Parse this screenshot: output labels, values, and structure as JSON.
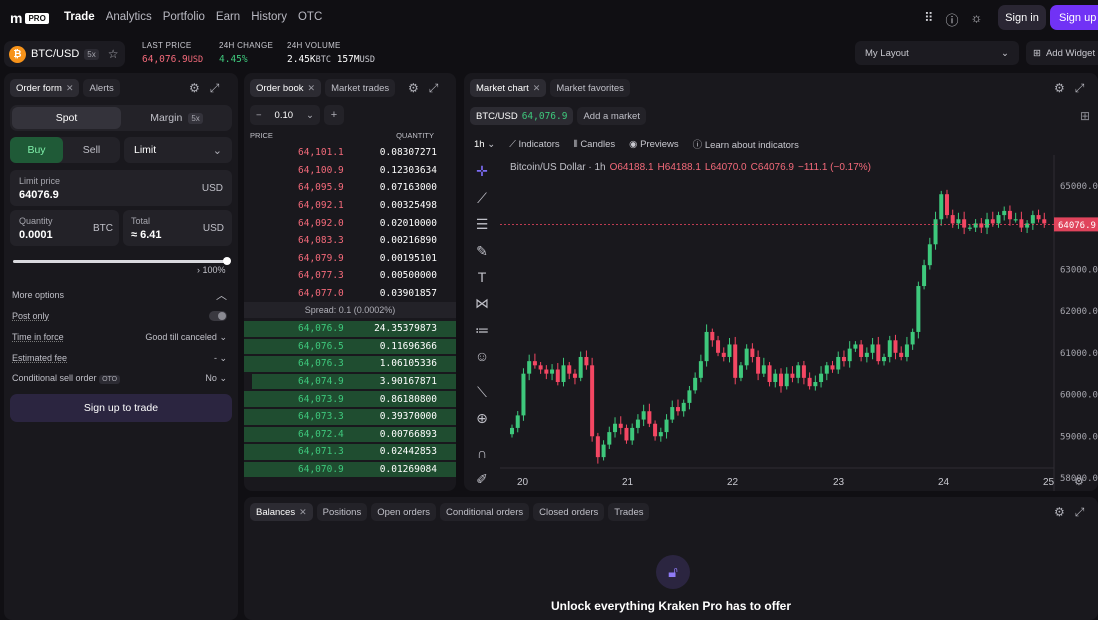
{
  "brand": {
    "logo": "m",
    "badge": "PRO"
  },
  "nav": [
    "Trade",
    "Analytics",
    "Portfolio",
    "Earn",
    "History",
    "OTC"
  ],
  "header": {
    "signin": "Sign in",
    "signup": "Sign up"
  },
  "ticker": {
    "pair": "BTC/USD",
    "leverage": "5x",
    "coin_glyph": "₿",
    "last_price_label": "LAST PRICE",
    "last_price": "64,076.9",
    "last_price_ccy": "USD",
    "change_label": "24H CHANGE",
    "change": "4.45%",
    "volume_label": "24H VOLUME",
    "volume_btc": "2.45K",
    "volume_btc_ccy": "BTC",
    "volume_usd": "157M",
    "volume_usd_ccy": "USD",
    "layout": "My Layout",
    "add_widget": "Add Widget"
  },
  "order_form": {
    "tabs": [
      "Order form",
      "Alerts"
    ],
    "spot": "Spot",
    "margin": "Margin",
    "margin_lev": "5x",
    "buy": "Buy",
    "sell": "Sell",
    "order_type": "Limit",
    "limit_label": "Limit price",
    "limit_value": "64076.9",
    "limit_ccy": "USD",
    "qty_label": "Quantity",
    "qty_value": "0.0001",
    "qty_ccy": "BTC",
    "total_label": "Total",
    "total_value": "≈ 6.41",
    "total_ccy": "USD",
    "slider_pct": "100%",
    "slider_fraction": 1.0,
    "more_options": "More options",
    "post_only": "Post only",
    "tif_label": "Time in force",
    "tif_value": "Good till canceled",
    "fee_label": "Estimated fee",
    "fee_value": "-",
    "cond_label": "Conditional sell order",
    "cond_badge": "OTO",
    "cond_value": "No",
    "cta": "Sign up to trade"
  },
  "order_book": {
    "tabs": [
      "Order book",
      "Market trades"
    ],
    "tick": "0.10",
    "col_price": "PRICE",
    "col_qty": "QUANTITY",
    "asks": [
      [
        "64,101.1",
        "0.08307271"
      ],
      [
        "64,100.9",
        "0.12303634"
      ],
      [
        "64,095.9",
        "0.07163000"
      ],
      [
        "64,092.1",
        "0.00325498"
      ],
      [
        "64,092.0",
        "0.02010000"
      ],
      [
        "64,083.3",
        "0.00216890"
      ],
      [
        "64,079.9",
        "0.00195101"
      ],
      [
        "64,077.3",
        "0.00500000"
      ],
      [
        "64,077.0",
        "0.03901857"
      ]
    ],
    "spread": "Spread: 0.1 (0.0002%)",
    "bids": [
      [
        "64,076.9",
        "24.35379873",
        1.0
      ],
      [
        "64,076.5",
        "0.11696366",
        1.0
      ],
      [
        "64,076.3",
        "1.06105336",
        1.0
      ],
      [
        "64,074.9",
        "3.90167871",
        0.96
      ],
      [
        "64,073.9",
        "0.86180800",
        1.0
      ],
      [
        "64,073.3",
        "0.39370000",
        1.0
      ],
      [
        "64,072.4",
        "0.00766893",
        1.0
      ],
      [
        "64,071.3",
        "0.02442853",
        1.0
      ],
      [
        "64,070.9",
        "0.01269084",
        1.0
      ]
    ]
  },
  "market_chart": {
    "tabs": [
      "Market chart",
      "Market favorites"
    ],
    "pair_chip": "BTC/USD",
    "pair_price": "64,076.9",
    "add_market": "Add a market",
    "interval": "1h",
    "indicators": "Indicators",
    "candles": "Candles",
    "previews": "Previews",
    "learn": "Learn about indicators",
    "legend_title": "Bitcoin/US Dollar · 1h",
    "legend_o": "O64188.1",
    "legend_h": "H64188.1",
    "legend_l": "L64070.0",
    "legend_c": "C64076.9",
    "legend_chg": "−111.1 (−0.17%)",
    "price_tag": "64076.9"
  },
  "chart_data": {
    "type": "candlestick",
    "x_ticks": [
      "20",
      "21",
      "22",
      "23",
      "24",
      "25"
    ],
    "y_ticks": [
      "65000.0",
      "64000.0",
      "63000.0",
      "62000.0",
      "61000.0",
      "60000.0",
      "59000.0",
      "58000.0"
    ],
    "ylim": [
      58000,
      65500
    ],
    "last_price": 64076.9,
    "closes": [
      59200,
      59500,
      60500,
      60800,
      60700,
      60600,
      60500,
      60600,
      60300,
      60700,
      60500,
      60400,
      60900,
      60700,
      59000,
      58500,
      58800,
      59100,
      59300,
      59200,
      58900,
      59200,
      59400,
      59600,
      59300,
      59000,
      59100,
      59400,
      59700,
      59600,
      59800,
      60100,
      60400,
      60800,
      61500,
      61300,
      61000,
      60900,
      61200,
      60400,
      60700,
      61100,
      60900,
      60500,
      60700,
      60300,
      60500,
      60200,
      60500,
      60400,
      60700,
      60400,
      60200,
      60300,
      60500,
      60700,
      60600,
      60900,
      60800,
      61100,
      61200,
      60900,
      61000,
      61200,
      60800,
      60900,
      61300,
      61000,
      60900,
      61200,
      61500,
      62600,
      63100,
      63600,
      64200,
      64800,
      64300,
      64100,
      64200,
      64000,
      64000,
      64100,
      64000,
      64200,
      64100,
      64300,
      64400,
      64200,
      64200,
      64000,
      64100,
      64300,
      64200,
      64100
    ]
  },
  "bottom": {
    "tabs": [
      "Balances",
      "Positions",
      "Open orders",
      "Conditional orders",
      "Closed orders",
      "Trades"
    ],
    "unlock": "Unlock everything Kraken Pro has to offer"
  },
  "colors": {
    "bull": "#3ec87c",
    "bear": "#f44763",
    "accent": "#7132f5"
  }
}
